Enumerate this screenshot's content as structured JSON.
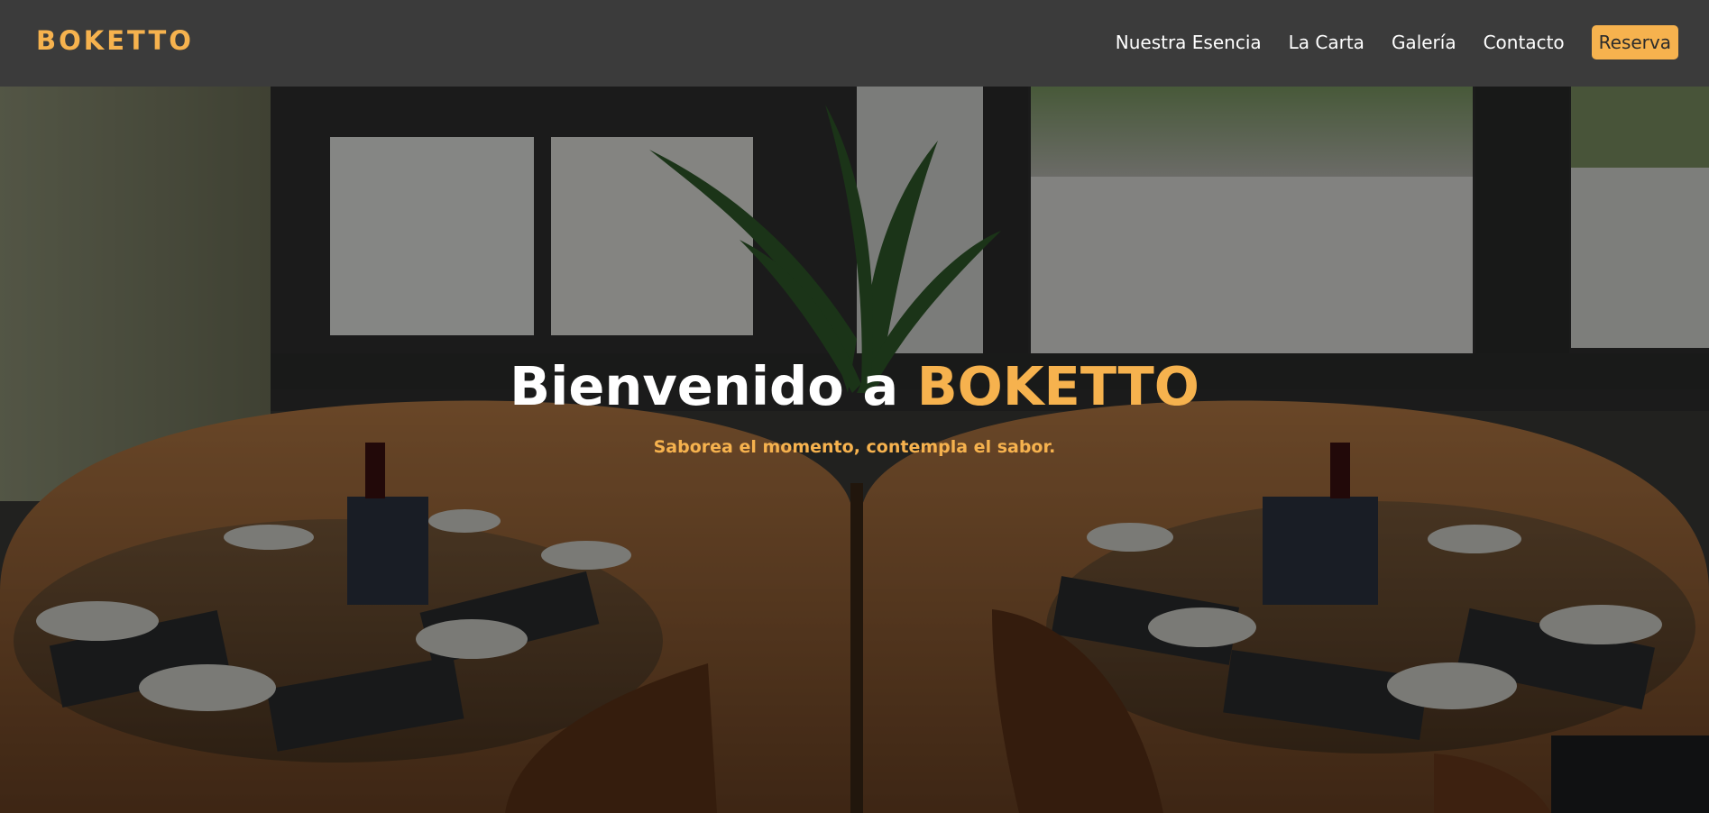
{
  "brand": {
    "logo_text": "BOKETTO",
    "accent_color": "#f6b24e"
  },
  "nav": {
    "items": [
      {
        "label": "Nuestra Esencia"
      },
      {
        "label": "La Carta"
      },
      {
        "label": "Galería"
      },
      {
        "label": "Contacto"
      }
    ],
    "cta_label": "Reserva"
  },
  "hero": {
    "title_prefix": "Bienvenido a ",
    "title_brand": "BOKETTO",
    "subtitle": "Saborea el momento, contempla el sabor."
  },
  "colors": {
    "header_bg": "#3b3b3b",
    "accent": "#f6b24e",
    "text_light": "#ffffff"
  }
}
